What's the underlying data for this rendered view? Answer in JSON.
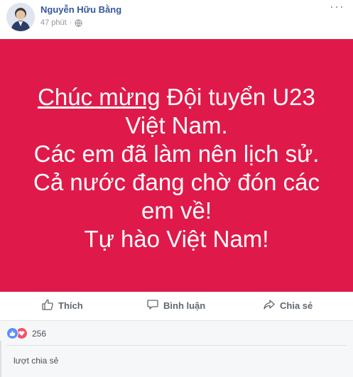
{
  "post": {
    "author": "Nguyễn Hữu Bằng",
    "time": "47 phút",
    "privacy_icon": "globe-icon",
    "more_icon": "more-dots-icon"
  },
  "banner": {
    "background": "#df1a4a",
    "underlined": "Chúc mừng",
    "line1_rest": " Đội tuyển U23 Việt Nam.",
    "line2": "Các em đã làm nên lịch sử.",
    "line3": "Cả nước đang chờ đón các em về!",
    "line4": "Tự hào Việt Nam!"
  },
  "actions": {
    "like": "Thích",
    "comment": "Bình luận",
    "share": "Chia sẻ"
  },
  "reactions": {
    "count": "256",
    "shares": "lượt chia sẻ"
  }
}
